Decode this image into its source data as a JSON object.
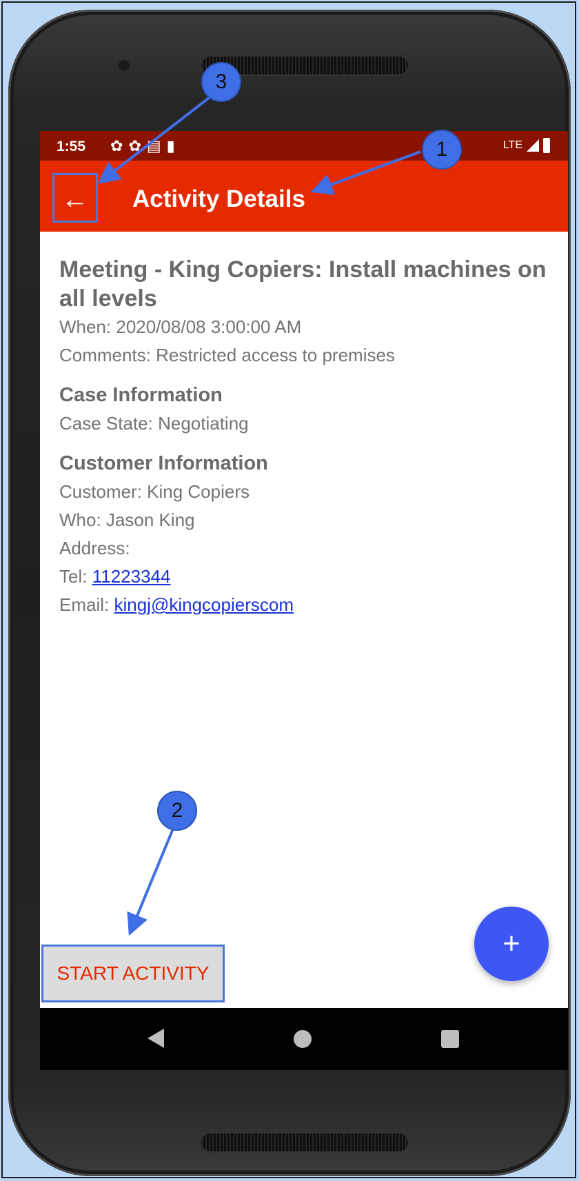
{
  "status_bar": {
    "time": "1:55",
    "icons": [
      "gear-icon",
      "gear-icon",
      "sim-icon",
      "sd-card-icon"
    ],
    "network": "LTE"
  },
  "app_bar": {
    "title": "Activity Details",
    "back_icon": "arrow-left-icon"
  },
  "activity": {
    "title": "Meeting - King Copiers: Install machines on all levels",
    "when": "When: 2020/08/08 3:00:00 AM",
    "comments": "Comments: Restricted access to premises"
  },
  "case_info": {
    "heading": "Case Information",
    "state": "Case State: Negotiating"
  },
  "customer_info": {
    "heading": "Customer Information",
    "customer": "Customer: King Copiers",
    "who": "Who: Jason King",
    "address": "Address:",
    "tel_label": "Tel:",
    "tel_value": "11223344",
    "email_label": "Email:",
    "email_value": "kingj@kingcopierscom"
  },
  "actions": {
    "start_label": "START ACTIVITY",
    "fab_label": "+"
  },
  "annotations": {
    "one": "1",
    "two": "2",
    "three": "3",
    "color": "#3f6ee6"
  },
  "colors": {
    "status_bar": "#8a1300",
    "app_bar": "#e52a00",
    "fab": "#3e56f5",
    "link": "#1a33d6"
  }
}
